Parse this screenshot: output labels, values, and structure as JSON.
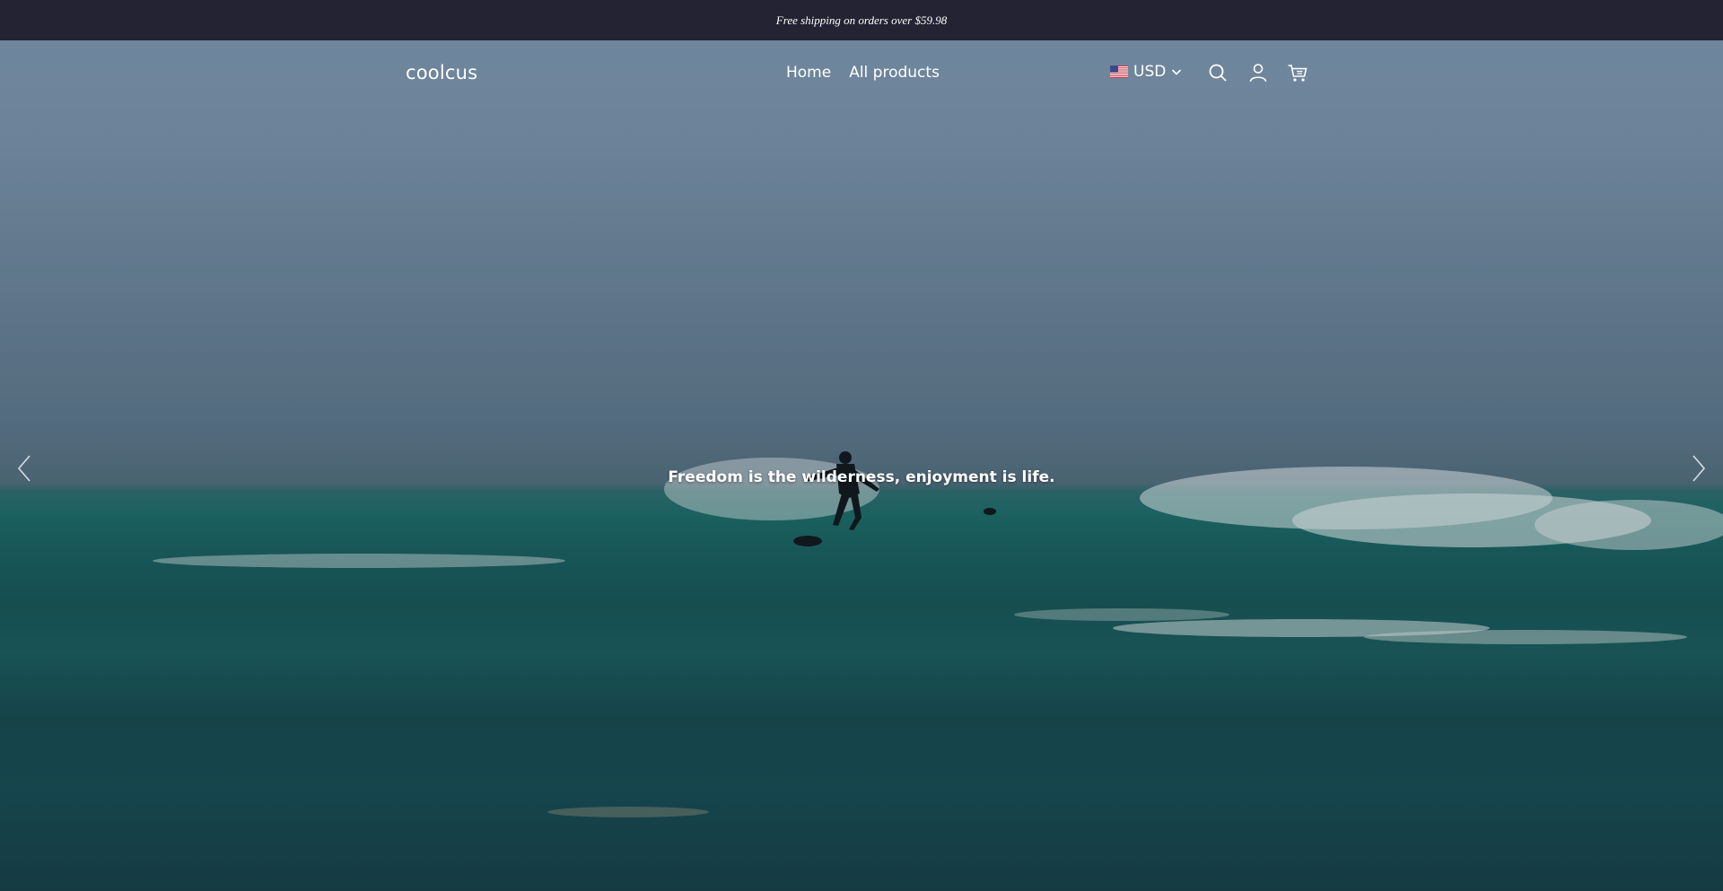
{
  "announcement": {
    "text": "Free shipping on orders over $59.98"
  },
  "header": {
    "logo": "coolcus",
    "nav": [
      {
        "label": "Home"
      },
      {
        "label": "All products"
      }
    ],
    "currency": {
      "code": "USD",
      "flag_icon": "us-flag-icon"
    },
    "icons": [
      "search-icon",
      "account-icon",
      "cart-icon"
    ]
  },
  "hero": {
    "tagline": "Freedom is the wilderness, enjoyment is life.",
    "prev_icon": "chevron-left-icon",
    "next_icon": "chevron-right-icon"
  },
  "colors": {
    "announcement_bg": "#232333",
    "text": "#ffffff",
    "sky": "#7d95ae",
    "sea": "#1a5e5e"
  }
}
